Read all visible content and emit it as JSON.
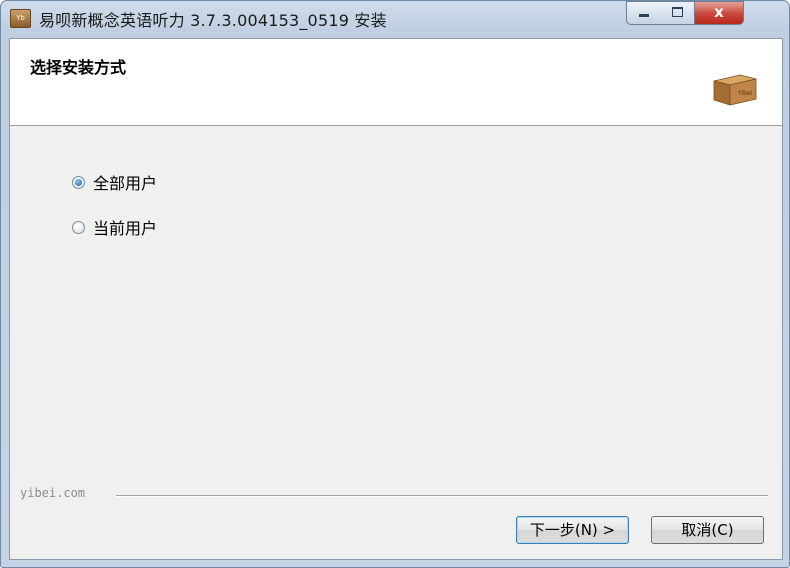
{
  "window": {
    "title": "易呗新概念英语听力 3.7.3.004153_0519 安装",
    "app_icon_text": "Yb",
    "controls": {
      "close_label": "x"
    }
  },
  "header": {
    "title": "选择安装方式",
    "logo_text": "Yibei"
  },
  "options": [
    {
      "label": "全部用户",
      "checked": true
    },
    {
      "label": "当前用户",
      "checked": false
    }
  ],
  "footer": {
    "brand": "yibei.com",
    "next_label": "下一步(N) >",
    "cancel_label": "取消(C)"
  },
  "colors": {
    "accent": "#3c7fb1",
    "close_red": "#c9453a"
  }
}
